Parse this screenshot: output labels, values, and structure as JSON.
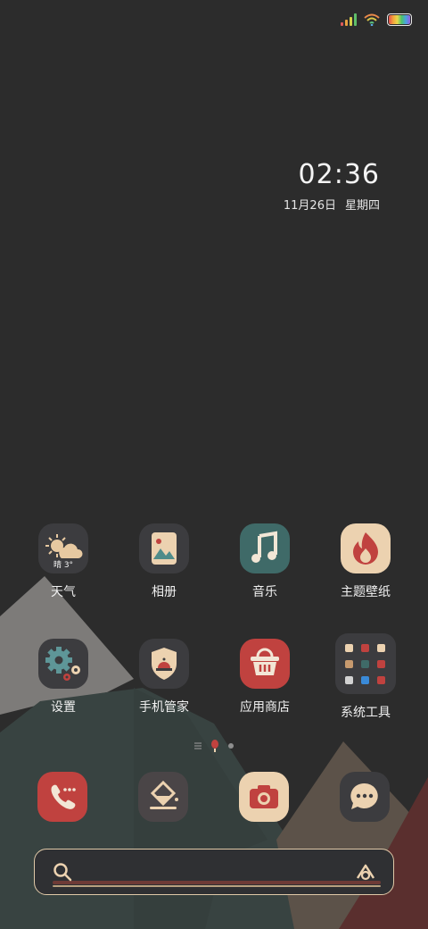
{
  "status_bar": {
    "icons": [
      "signal-icon",
      "wifi-icon",
      "battery-icon"
    ]
  },
  "clock": {
    "time": "02:36",
    "date": "11月26日",
    "weekday": "星期四"
  },
  "apps": [
    {
      "label": "天气",
      "icon": "weather-icon",
      "weather_text": "晴 3°"
    },
    {
      "label": "相册",
      "icon": "gallery-icon"
    },
    {
      "label": "音乐",
      "icon": "music-icon"
    },
    {
      "label": "主题壁纸",
      "icon": "theme-icon"
    },
    {
      "label": "设置",
      "icon": "gear-icon"
    },
    {
      "label": "手机管家",
      "icon": "shield-icon"
    },
    {
      "label": "应用商店",
      "icon": "basket-icon"
    },
    {
      "label": "系统工具",
      "icon": "folder-icon"
    }
  ],
  "dock": [
    {
      "icon": "phone-icon"
    },
    {
      "icon": "browser-icon"
    },
    {
      "icon": "camera-icon"
    },
    {
      "icon": "messages-icon"
    }
  ],
  "page_indicator": {
    "icons": [
      "list-icon",
      "balloon-icon",
      "dot-icon"
    ]
  },
  "search": {
    "icons": [
      "search-icon",
      "ai-assistant-icon"
    ]
  },
  "colors": {
    "background": "#2c2c2c",
    "tan": "#ecd2b0",
    "red": "#c0423f",
    "teal": "#3f6a68",
    "dark_icon": "#3c3c3f"
  }
}
